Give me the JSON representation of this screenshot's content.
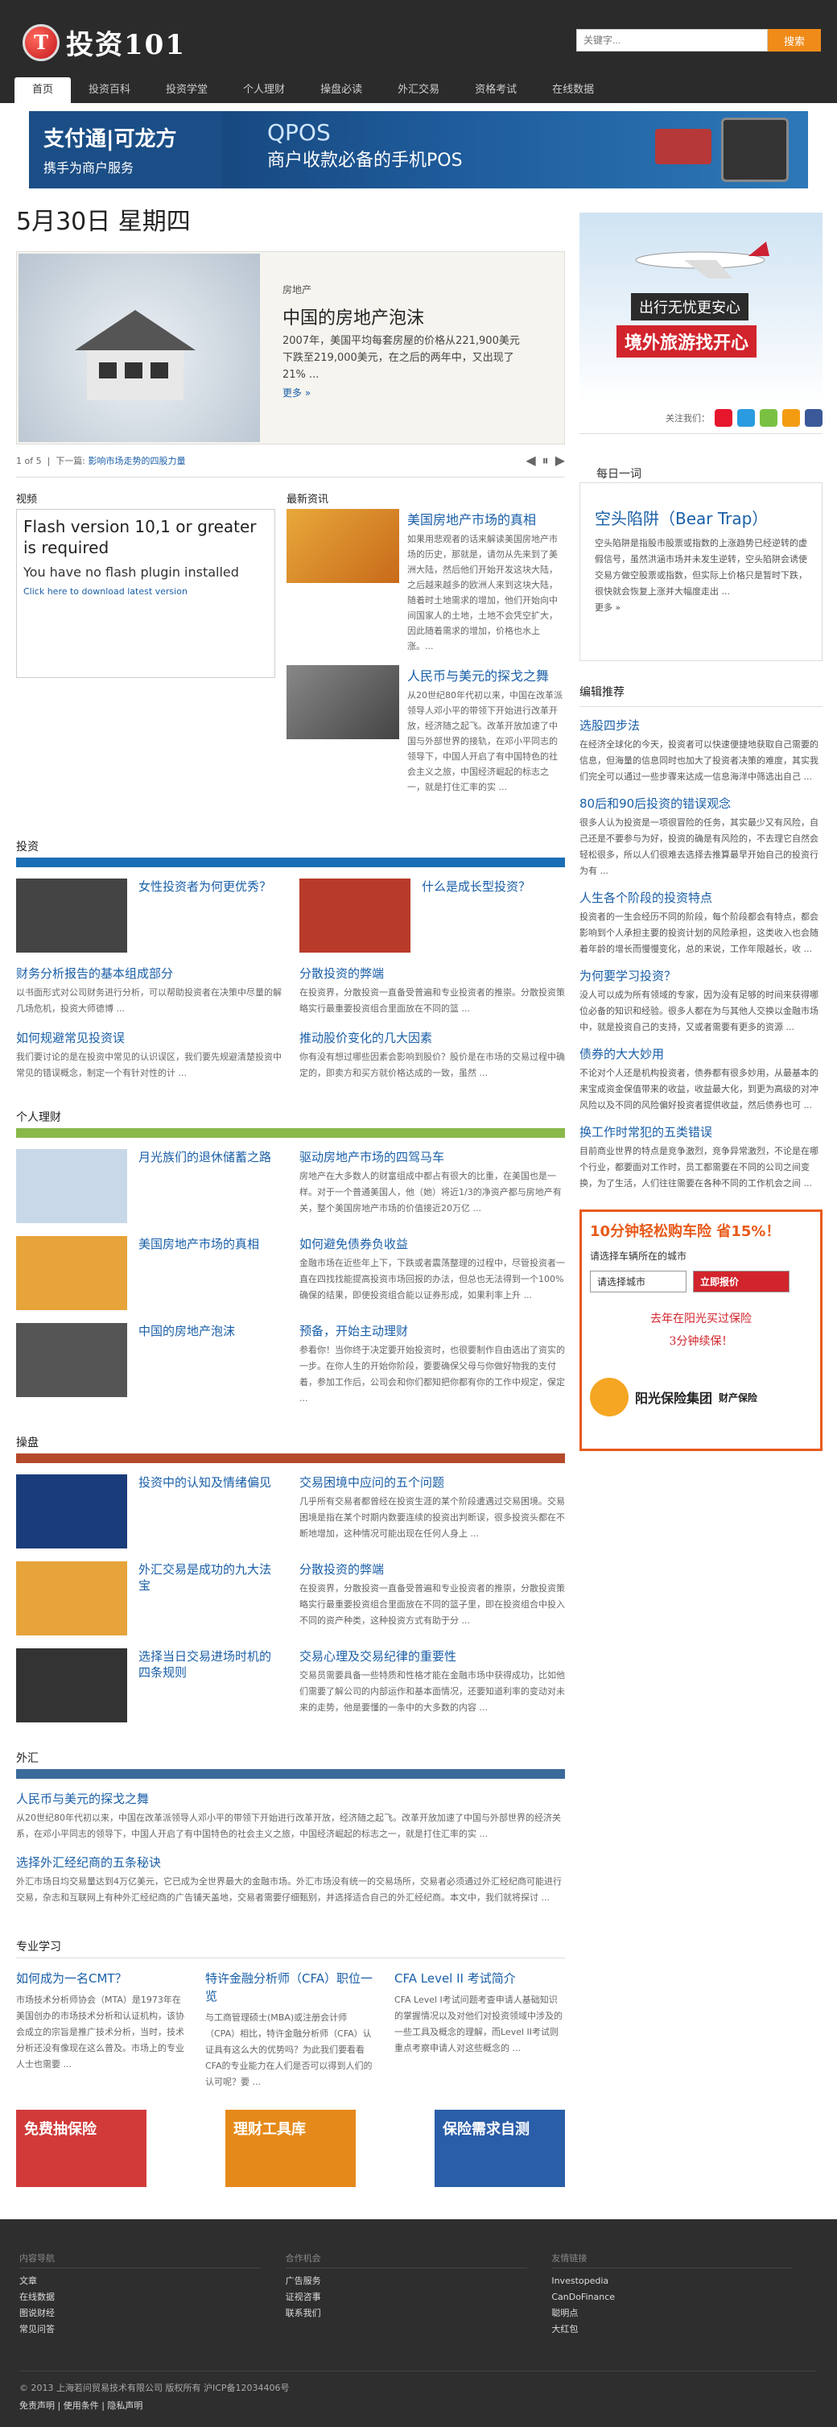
{
  "site": {
    "logo_mark": "T",
    "logo_text": "投资101"
  },
  "search": {
    "placeholder": "关键字...",
    "button": "搜索"
  },
  "nav": [
    "首页",
    "投资百科",
    "投资学堂",
    "个人理财",
    "操盘必读",
    "外汇交易",
    "资格考试",
    "在线数据"
  ],
  "banner": {
    "left1": "支付通|可龙方",
    "left2": "携手为商户服务",
    "qpos": "QPOS",
    "slogan": "商户收款必备的手机POS"
  },
  "date": "5月30日 星期四",
  "slider": {
    "category": "房地产",
    "title": "中国的房地产泡沫",
    "text": "2007年，美国平均每套房屋的价格从221,900美元下跌至219,000美元，在之后的两年中，又出现了21% ...",
    "more": "更多 »",
    "counter": "1 of 5",
    "next_label": "下一篇:",
    "next": "影响市场走势的四股力量"
  },
  "video": {
    "label": "视频",
    "l1": "Flash version 10,1 or greater is required",
    "l2": "You have no flash plugin installed",
    "l3": "Click here to download latest version"
  },
  "latest": {
    "label": "最新资讯",
    "items": [
      {
        "title": "美国房地产市场的真相",
        "text": "如果用悲观者的话来解读美国房地产市场的历史，那就是，请勿从先来到了美洲大陆，然后他们开始开发这块大陆，之后越来越多的欧洲人来到这块大陆，随着时土地需求的增加，他们开始向中间国家人的土地，土地不会凭空扩大，因此随着需求的增加，价格也水上涨。..."
      },
      {
        "title": "人民币与美元的探戈之舞",
        "text": "从20世纪80年代初以来，中国在改革派领导人邓小平的带领下开始进行改革开放，经济随之起飞。改革开放加速了中国与外部世界的接轨，在邓小平同志的领导下，中国人开启了有中国特色的社会主义之旅，中国经济崛起的标志之一，就是打住汇率的实 ..."
      }
    ]
  },
  "sections": [
    {
      "head": "投资",
      "color": "#1a6eb6",
      "items": [
        {
          "title": "女性投资者为何更优秀？",
          "thumb": "#444"
        },
        {
          "title": "什么是成长型投资？",
          "thumb": "#b83a2a"
        },
        {
          "title": "财务分析报告的基本组成部分",
          "text": "以书面形式对公司财务进行分析，可以帮助投资者在决策中尽量的解几场危机，投资大师德博 ..."
        },
        {
          "title": "分散投资的弊端",
          "text": "在投资界，分散投资一直备受普遍和专业投资者的推崇。分散投资策略实行最重要投资组合里面放在不同的篮 ..."
        },
        {
          "title": "如何规避常见投资误",
          "text": "我们要讨论的是在投资中常见的认识误区，我们要先规避清楚投资中常见的错误概念，制定一个有针对性的计 ..."
        },
        {
          "title": "推动股价变化的几大因素",
          "text": "你有没有想过哪些因素会影响到股价？股价是在市场的交易过程中确定的，即卖方和买方就价格达成的一致，虽然 ..."
        }
      ]
    },
    {
      "head": "个人理财",
      "color": "#8ab84a",
      "items": [
        {
          "title": "月光族们的退休储蓄之路",
          "thumb": "#c8d8e8"
        },
        {
          "title": "驱动房地产市场的四驾马车",
          "text": "房地产在大多数人的财富组成中都占有很大的比重，在美国也是一样。对于一个普通美国人，他（她）将近1/3的净资产都与房地产有关，整个美国房地产市场的价值接近20万亿 ..."
        },
        {
          "title": "美国房地产市场的真相",
          "thumb": "#e6a43a"
        },
        {
          "title": "如何避免债券负收益",
          "text": "金融市场在近些年上下，下跌或者震荡整理的过程中，尽管投资者一直在四找找能提高投资市场回报的办法，但总也无法得到一个100%确保的结果，即使投资组合能以证券形成，如果利率上升 ..."
        },
        {
          "title": "中国的房地产泡沫",
          "thumb": "#555"
        },
        {
          "title": "预备，开始主动理财",
          "text": "参看你！当你终于决定要开始投资时，也很要制作自由选出了资实的一步。在你人生的开始你阶段，要要确保父母与你做好物我的支付着，参加工作后，公司会和你们都知把你都有你的工作中规定，保定 ..."
        }
      ]
    },
    {
      "head": "操盘",
      "color": "#b54a2a",
      "items": [
        {
          "title": "投资中的认知及情绪偏见",
          "thumb": "#1a3c7a"
        },
        {
          "title": "交易困境中应问的五个问题",
          "text": "几乎所有交易者都曾经在投资生涯的某个阶段遭遇过交易困境。交易困境是指在某个时期内数要连续的投资出判断误，很多投资头都在不断地增加，这种情况可能出现在任何人身上 ..."
        },
        {
          "title": "外汇交易是成功的九大法宝",
          "thumb": "#e6a43a"
        },
        {
          "title": "分散投资的弊端",
          "text": "在投资界，分散投资一直备受普遍和专业投资者的推崇，分散投资策略实行最重要投资组合里面放在不同的篮子里，即在投资组合中投入不同的资产种类，这种投资方式有助于分 ..."
        },
        {
          "title": "选择当日交易进场时机的四条规则",
          "thumb": "#333"
        },
        {
          "title": "交易心理及交易纪律的重要性",
          "text": "交易员需要具备一些特质和性格才能在金融市场中获得成功，比如他们需要了解公司的内部运作和基本面情况，还要知道利率的变动对未来的走势，他是要懂的一条中的大多数的内容 ..."
        }
      ]
    }
  ],
  "forex": {
    "head": "外汇",
    "color": "#3a6a9a",
    "items": [
      {
        "title": "人民币与美元的探戈之舞",
        "text": "从20世纪80年代初以来，中国在改革派领导人邓小平的带领下开始进行改革开放，经济随之起飞。改革开放加速了中国与外部世界的经济关系，在邓小平同志的领导下，中国人开启了有中国特色的社会主义之旅，中国经济崛起的标志之一，就是打住汇率的实 ..."
      },
      {
        "title": "选择外汇经纪商的五条秘诀",
        "text": "外汇市场日均交易量达到4万亿美元，它已成为全世界最大的金融市场。外汇市场没有统一的交易场所，交易者必须通过外汇经纪商可能进行交易，杂志和互联网上有种外汇经纪商的广告铺天盖地，交易者需要仔细甄别，并选择适合自己的外汇经纪商。本文中，我们就将探讨 ..."
      }
    ]
  },
  "pro": {
    "head": "专业学习",
    "items": [
      {
        "title": "如何成为一名CMT？",
        "text": "市场技术分析师协会（MTA）是1973年在美国创办的市场技术分析和认证机构，该协会成立的宗旨是推广技术分析，当时，技术分析还没有像现在这么普及。市场上的专业人士也需要 ..."
      },
      {
        "title": "特许金融分析师（CFA）职位一览",
        "text": "与工商管理硕士(MBA)或注册会计师（CPA）相比，特许金融分析师（CFA）认证具有这么大的优势吗？为此我们要看看CFA的专业能力在人们是否可以得到人们的认可呢？要 ..."
      },
      {
        "title": "CFA Level II 考试简介",
        "text": "CFA Level I考试问题考查申请人基础知识的掌握情况以及对他们对投资领域中涉及的一些工具及概念的理解，而Level II考试则重点考察申请人对这些概念的 ..."
      }
    ]
  },
  "promos": [
    {
      "label": "免费抽保险",
      "color": "#d23a3a"
    },
    {
      "label": "理财工具库",
      "color": "#e58a1a"
    },
    {
      "label": "保险需求自测",
      "color": "#2a5ea8"
    }
  ],
  "side": {
    "ad1": "出行无忧更安心",
    "ad2": "境外旅游找开心",
    "follow": "关注我们：",
    "daily": {
      "head": "每日一词",
      "title": "空头陷阱（Bear Trap）",
      "text": "空头陷阱是指股市股票或指数的上涨趋势已经逆转的虚假信号，虽然洪涵市场并未发生逆转，空头陷阱会诱使交易方做空股票或指数，但实际上价格只是暂时下跌，很快就会恢复上涨并大幅度走出 ...",
      "more": "更多 »"
    },
    "edit": {
      "head": "编辑推荐",
      "items": [
        {
          "title": "选股四步法",
          "text": "在经济全球化的今天，投资者可以快速便捷地获取自己需要的信息，但海量的信息同时也加大了投资者决策的难度，其实我们完全可以通过一些步骤来达成一信息海洋中筛选出自己 ..."
        },
        {
          "title": "80后和90后投资的错误观念",
          "text": "很多人认为投资是一项很冒险的任务，其实最少又有风险，自己还是不要参与为好，投资的确是有风险的，不去理它自然会轻松很多，所以人们很难去选择去推算最早开始自己的投资行为有 ..."
        },
        {
          "title": "人生各个阶段的投资特点",
          "text": "投资者的一生会经历不同的阶段，每个阶段都会有特点，都会影响到个人承担主要的投资计划的风险承担，这类收入也会随着年龄的增长而慢慢变化，总的来说，工作年限越长，收 ..."
        },
        {
          "title": "为何要学习投资？",
          "text": "没人可以成为所有领域的专家，因为没有足够的时间来获得哪位必备的知识和经验。很多人都在为与其他人交换以金融市场中，就是投资自己的支持，又或者需要有更多的资源 ..."
        },
        {
          "title": "债券的大大妙用",
          "text": "不论对个人还是机构投资者，债券都有很多妙用，从最基本的来宝成资金保值带来的收益，收益最大化，到更为高级的对冲风险以及不同的风险偏好投资者提供收益，然后债券也可 ..."
        },
        {
          "title": "换工作时常犯的五类错误",
          "text": "目前商业世界的特点是竞争激烈，竞争异常激烈，不论是在哪个行业，都要面对工作时，员工都需要在不同的公司之间变换，为了生活，人们往往需要在各种不同的工作机会之间 ..."
        }
      ]
    },
    "insure": {
      "title": "10分钟轻松购车险",
      "promo": "省15%！",
      "sub": "请选择车辆所在的城市",
      "select": "请选择城市",
      "btn": "立即报价",
      "note1": "去年在阳光买过保险",
      "note2": "3分钟续保！",
      "company": "阳光保险集团",
      "company2": "财产保险"
    }
  },
  "footer": {
    "cols": [
      {
        "head": "内容导航",
        "items": [
          "文章",
          "在线数据",
          "图说财经",
          "常见问答"
        ]
      },
      {
        "head": "合作机会",
        "items": [
          "广告服务",
          "证视咨事",
          "联系我们"
        ]
      },
      {
        "head": "友情链接",
        "items": [
          "Investopedia",
          "CanDoFinance",
          "聪明点",
          "大红包"
        ]
      }
    ],
    "copy": "© 2013 上海若问贸易技术有限公司 版权所有 沪ICP备12034406号",
    "links": "免责声明 | 使用条件 | 隐私声明"
  }
}
